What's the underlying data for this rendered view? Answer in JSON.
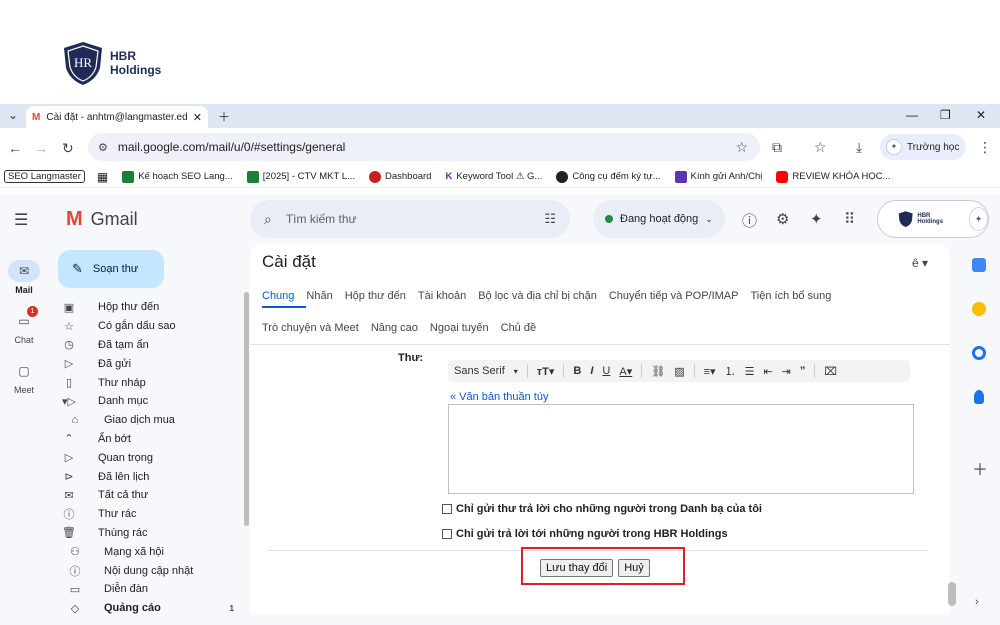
{
  "brand": {
    "line1": "HBR",
    "line2": "Holdings",
    "color": "#1f2b55"
  },
  "browser": {
    "tab_title": "Cài đặt - anhtm@langmaster.ed",
    "url": "mail.google.com/mail/u/0/#settings/general",
    "profile_name": "Trường học",
    "icons": [
      "back-arrow-icon",
      "forward-arrow-icon",
      "reload-icon",
      "star-icon",
      "extensions-icon",
      "bookmark-star-icon",
      "download-icon",
      "more-vert-icon"
    ],
    "bookmarks": [
      {
        "label": "SEO Langmaster"
      },
      {
        "label": "",
        "icon": "apps-grid-icon"
      },
      {
        "label": "Kế hoạch SEO Lang...",
        "color": "#188038"
      },
      {
        "label": "[2025] - CTV MKT L...",
        "color": "#188038"
      },
      {
        "label": "Dashboard",
        "color": "#c5221f"
      },
      {
        "label": "Keyword Tool ⚠ G...",
        "color": "#7b1fa2"
      },
      {
        "label": "Công cụ đếm ký tự...",
        "color": "#202124"
      },
      {
        "label": "Kính gửi Anh/Chị",
        "color": "#5e35b1"
      },
      {
        "label": "REVIEW KHÓA HỌC...",
        "color": "#ff0000"
      }
    ]
  },
  "gmail": {
    "logo_text": "Gmail",
    "search_placeholder": "Tìm kiếm thư",
    "status": "Đang hoạt động",
    "account_label_line1": "HBR",
    "account_label_line2": "Holdings",
    "compose_label": "Soạn thư",
    "rail": [
      {
        "label": "Mail",
        "icon": "mail-icon",
        "active": true
      },
      {
        "label": "Chat",
        "icon": "chat-icon",
        "badge": "1"
      },
      {
        "label": "Meet",
        "icon": "video-icon"
      }
    ],
    "folders": [
      {
        "label": "Hộp thư đến",
        "icon": "inbox-icon"
      },
      {
        "label": "Có gắn dấu sao",
        "icon": "star-icon"
      },
      {
        "label": "Đã tạm ẩn",
        "icon": "clock-icon"
      },
      {
        "label": "Đã gửi",
        "icon": "send-icon"
      },
      {
        "label": "Thư nháp",
        "icon": "draft-icon"
      },
      {
        "label": "Danh mục",
        "icon": "label-icon"
      },
      {
        "label": "Giao dịch mua",
        "icon": "bag-icon",
        "indent": true
      },
      {
        "label": "Ẩn bớt",
        "icon": "chevron-up-icon"
      },
      {
        "label": "Quan trọng",
        "icon": "important-icon"
      },
      {
        "label": "Đã lên lịch",
        "icon": "scheduled-icon"
      },
      {
        "label": "Tất cả thư",
        "icon": "all-mail-icon"
      },
      {
        "label": "Thư rác",
        "icon": "spam-icon"
      },
      {
        "label": "Thùng rác",
        "icon": "trash-icon"
      },
      {
        "label": "Mạng xã hội",
        "icon": "people-icon",
        "indent": true
      },
      {
        "label": "Nội dung cập nhật",
        "icon": "info-icon",
        "indent": true
      },
      {
        "label": "Diễn đàn",
        "icon": "forum-icon",
        "indent": true
      },
      {
        "label": "Quảng cáo",
        "icon": "tag-icon",
        "indent": true,
        "count": "1",
        "bold": true
      }
    ]
  },
  "settings": {
    "title": "Cài đặt",
    "lang_icon": "ê ▾",
    "tabs_row1": [
      "Chung",
      "Nhãn",
      "Hộp thư đến",
      "Tài khoản",
      "Bộ lọc và địa chỉ bị chặn",
      "Chuyển tiếp và POP/IMAP",
      "Tiện ích bổ sung"
    ],
    "tabs_row2": [
      "Trò chuyện và Meet",
      "Nâng cao",
      "Ngoại tuyến",
      "Chủ đề"
    ],
    "signature_label": "Thư:",
    "font_name": "Sans Serif",
    "plain_text_link": "« Văn bản thuần túy",
    "checkbox1": "Chỉ gửi thư trả lời cho những người trong Danh bạ của tôi",
    "checkbox2": "Chỉ gửi trả lời tới những người trong HBR Holdings",
    "save_label": "Lưu thay đổi",
    "cancel_label": "Huỷ"
  },
  "colors": {
    "accent": "#0b57d0",
    "highlight": "#e21f26",
    "compose_bg": "#c2e7ff"
  }
}
